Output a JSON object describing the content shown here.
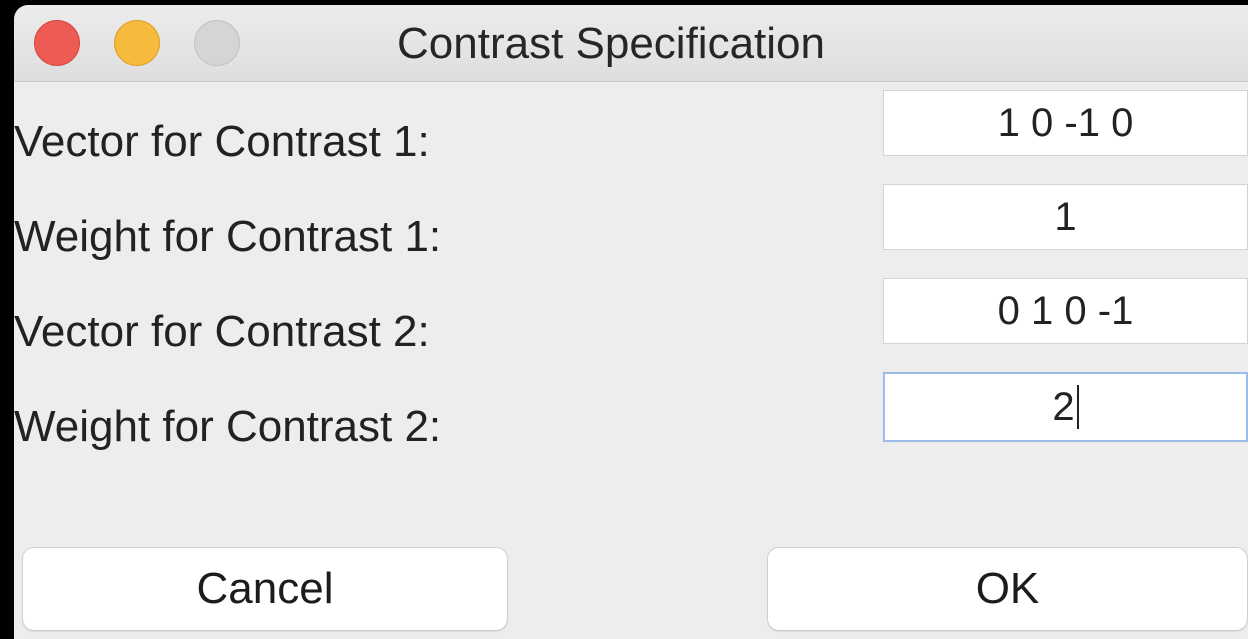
{
  "window": {
    "title": "Contrast Specification"
  },
  "fields": [
    {
      "label": "Vector for Contrast 1:",
      "value": "1 0 -1 0"
    },
    {
      "label": "Weight for Contrast 1:",
      "value": "1"
    },
    {
      "label": "Vector for Contrast 2:",
      "value": "0 1 0 -1"
    },
    {
      "label": "Weight for Contrast 2:",
      "value": "2"
    }
  ],
  "buttons": {
    "cancel_label": "Cancel",
    "ok_label": "OK"
  },
  "colors": {
    "close": "#ee5b55",
    "minimize": "#f6bb3c",
    "zoom_inactive": "#d5d5d5",
    "focus_ring": "#9bbbe9"
  }
}
